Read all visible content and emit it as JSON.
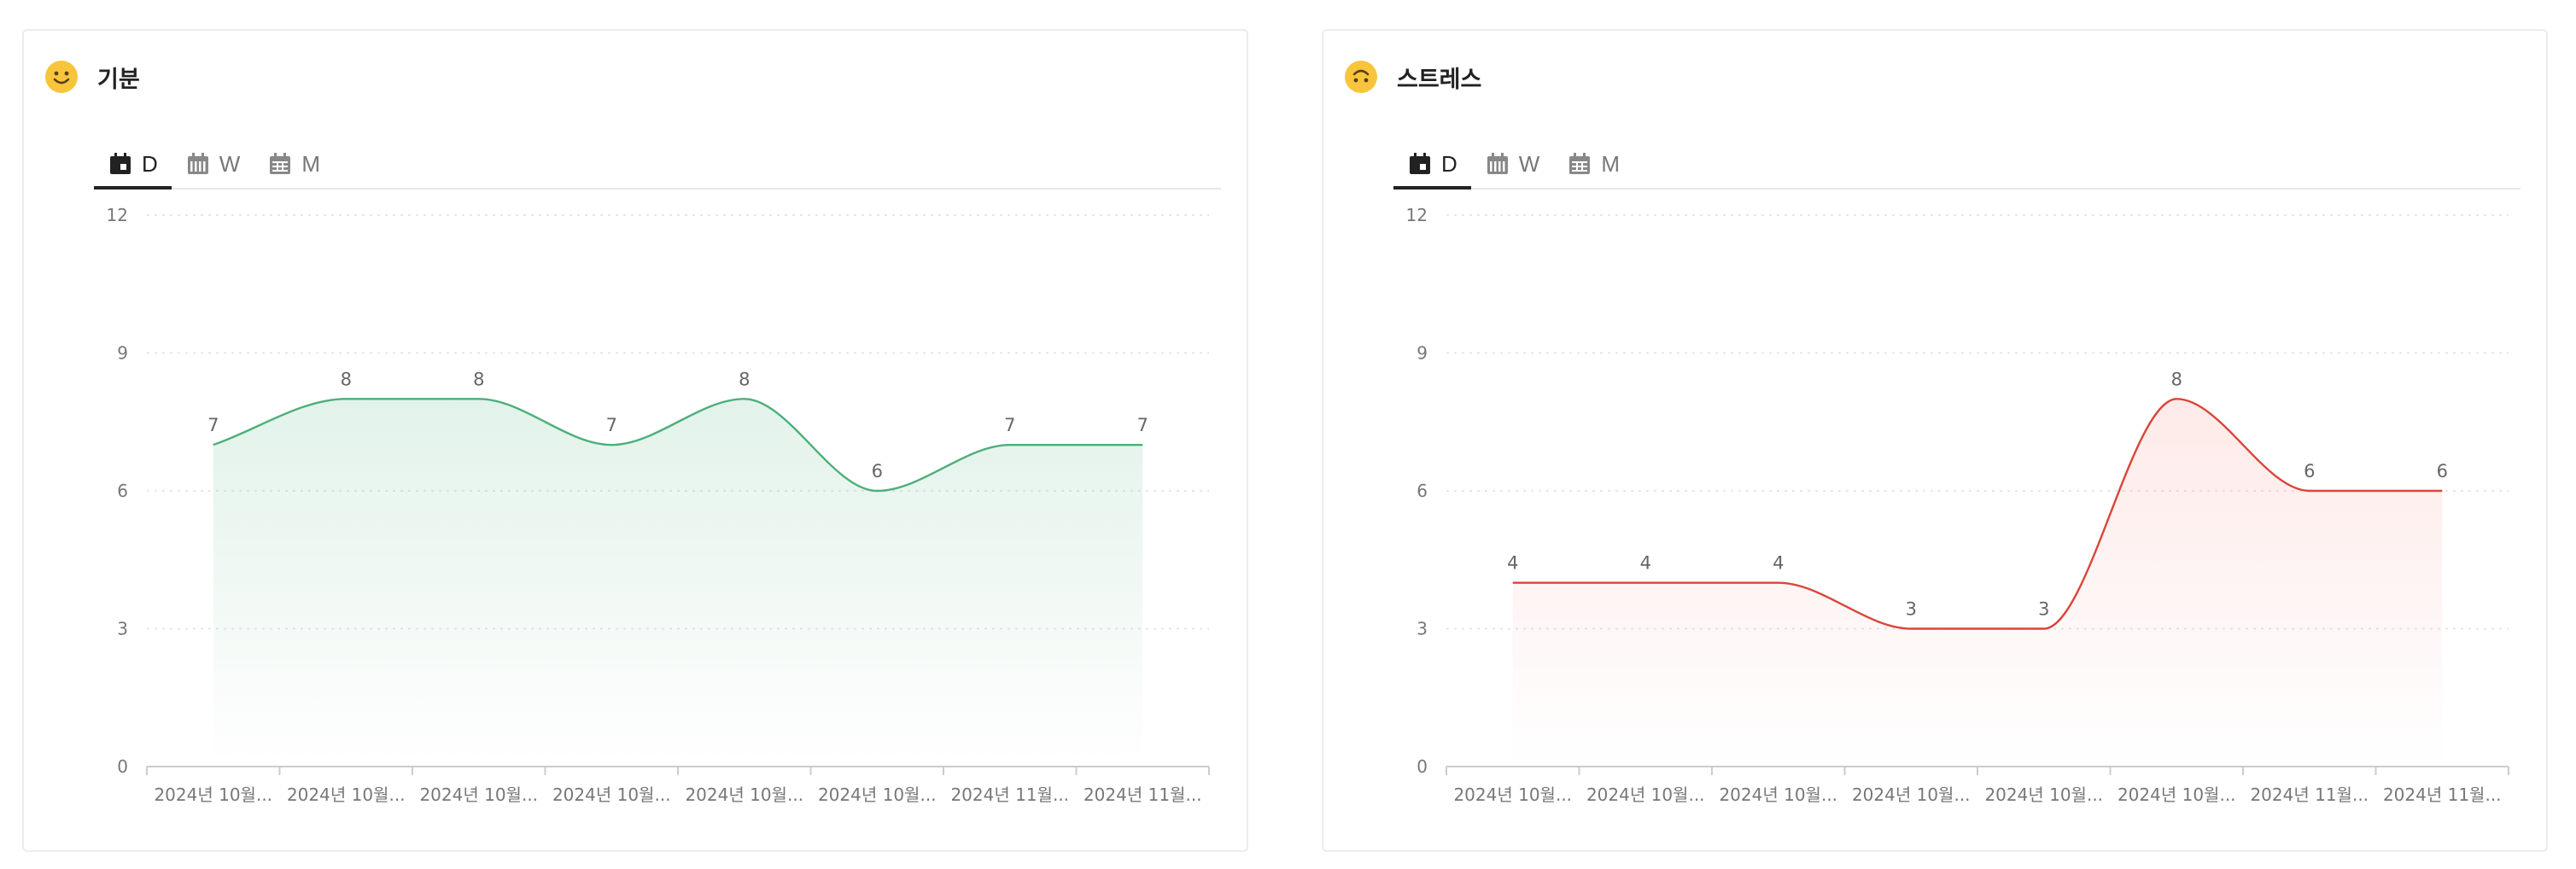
{
  "cards": [
    {
      "title": "기분",
      "icon": "smiling-face-icon",
      "tabs": [
        {
          "label": "D",
          "icon": "calendar-day-icon",
          "active": true
        },
        {
          "label": "W",
          "icon": "calendar-week-icon",
          "active": false
        },
        {
          "label": "M",
          "icon": "calendar-month-icon",
          "active": false
        }
      ],
      "chart_data": {
        "type": "area",
        "categories": [
          "2024년 10월...",
          "2024년 10월...",
          "2024년 10월...",
          "2024년 10월...",
          "2024년 10월...",
          "2024년 10월...",
          "2024년 11월...",
          "2024년 11월..."
        ],
        "values": [
          7,
          8,
          8,
          7,
          8,
          6,
          7,
          7
        ],
        "ylim": [
          0,
          12
        ],
        "yticks": [
          0,
          3,
          6,
          9,
          12
        ],
        "grid": true,
        "color": "#4caf7a",
        "fill_color": "#4caf7a"
      }
    },
    {
      "title": "스트레스",
      "icon": "upside-down-face-icon",
      "tabs": [
        {
          "label": "D",
          "icon": "calendar-day-icon",
          "active": true
        },
        {
          "label": "W",
          "icon": "calendar-week-icon",
          "active": false
        },
        {
          "label": "M",
          "icon": "calendar-month-icon",
          "active": false
        }
      ],
      "chart_data": {
        "type": "area",
        "categories": [
          "2024년 10월...",
          "2024년 10월...",
          "2024년 10월...",
          "2024년 10월...",
          "2024년 10월...",
          "2024년 10월...",
          "2024년 11월...",
          "2024년 11월..."
        ],
        "values": [
          4,
          4,
          4,
          3,
          3,
          8,
          6,
          6
        ],
        "ylim": [
          0,
          12
        ],
        "yticks": [
          0,
          3,
          6,
          9,
          12
        ],
        "grid": true,
        "color": "#d9463a",
        "fill_color": "#f47c72"
      }
    }
  ]
}
